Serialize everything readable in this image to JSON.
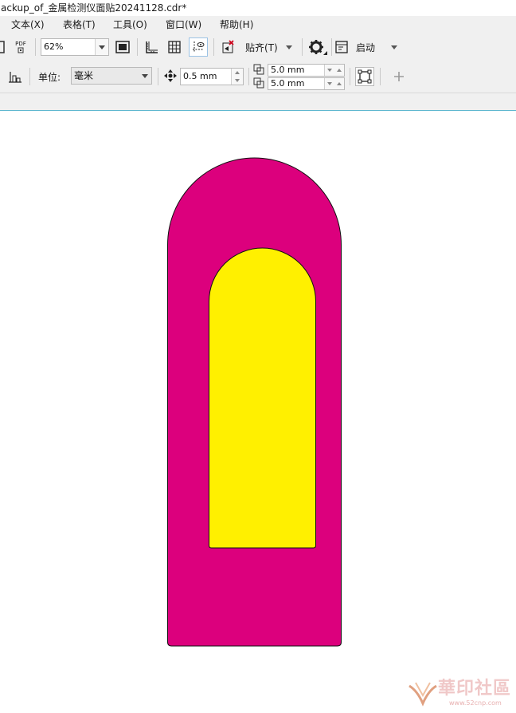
{
  "window": {
    "title": "ackup_of_金属检测仪面贴20241128.cdr*"
  },
  "menu": [
    {
      "label": "文本(X)",
      "name": "menu-text"
    },
    {
      "label": "表格(T)",
      "name": "menu-table"
    },
    {
      "label": "工具(O)",
      "name": "menu-tools"
    },
    {
      "label": "窗口(W)",
      "name": "menu-window"
    },
    {
      "label": "帮助(H)",
      "name": "menu-help"
    }
  ],
  "toolbar": {
    "pdf_label": "PDF",
    "zoom_value": "62%",
    "snap_label": "贴齐(T)",
    "startup_label": "启动"
  },
  "propbar": {
    "units_label": "单位:",
    "units_value": "毫米",
    "nudge_value": "0.5 mm",
    "dup_x_value": "5.0 mm",
    "dup_y_value": "5.0 mm"
  },
  "colors": {
    "outer_shape": "#dc007d",
    "inner_shape": "#fff000",
    "ruler_line": "#5fb7cf"
  },
  "watermark": {
    "text": "華印社區",
    "sub": "www.52cnp.com"
  }
}
